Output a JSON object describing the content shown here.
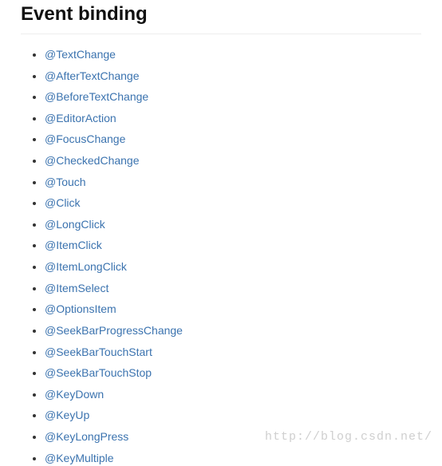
{
  "heading": "Event binding",
  "items": [
    "@TextChange",
    "@AfterTextChange",
    "@BeforeTextChange",
    "@EditorAction",
    "@FocusChange",
    "@CheckedChange",
    "@Touch",
    "@Click",
    "@LongClick",
    "@ItemClick",
    "@ItemLongClick",
    "@ItemSelect",
    "@OptionsItem",
    "@SeekBarProgressChange",
    "@SeekBarTouchStart",
    "@SeekBarTouchStop",
    "@KeyDown",
    "@KeyUp",
    "@KeyLongPress",
    "@KeyMultiple"
  ],
  "watermark": "http://blog.csdn.net/"
}
